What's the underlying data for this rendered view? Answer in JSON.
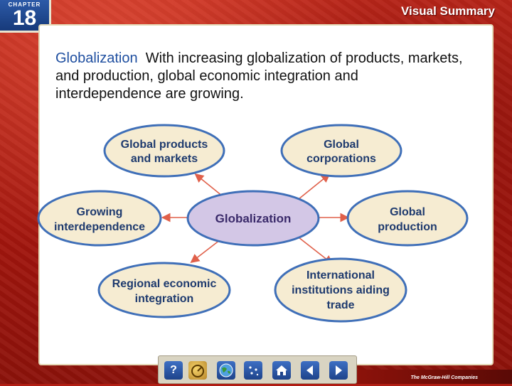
{
  "header": {
    "chapter_label": "CHAPTER",
    "chapter_number": "18",
    "title": "Visual Summary"
  },
  "intro": {
    "term": "Globalization",
    "text": "With increasing globalization of products, markets, and production, global economic integration and interdependence are growing."
  },
  "diagram": {
    "center": [
      "Globalization"
    ],
    "nodes": {
      "top_left": [
        "Global products",
        "and markets"
      ],
      "top_right": [
        "Global",
        "corporations"
      ],
      "mid_left": [
        "Growing",
        "interdependence"
      ],
      "mid_right": [
        "Global",
        "production"
      ],
      "bottom_left": [
        "Regional economic",
        "integration"
      ],
      "bottom_right": [
        "International",
        "institutions aiding",
        "trade"
      ]
    },
    "colors": {
      "node_fill": "#f6ecd2",
      "node_stroke": "#3f6fb8",
      "center_fill": "#d3c7e6",
      "arrow": "#e0604a"
    }
  },
  "toolbar": {
    "help_symbol": "?",
    "items": [
      "help-icon",
      "gauge-icon",
      "globe-icon",
      "stars-icon",
      "home-icon",
      "previous-icon",
      "next-icon"
    ]
  },
  "footer": {
    "publisher": "The McGraw-Hill Companies"
  }
}
